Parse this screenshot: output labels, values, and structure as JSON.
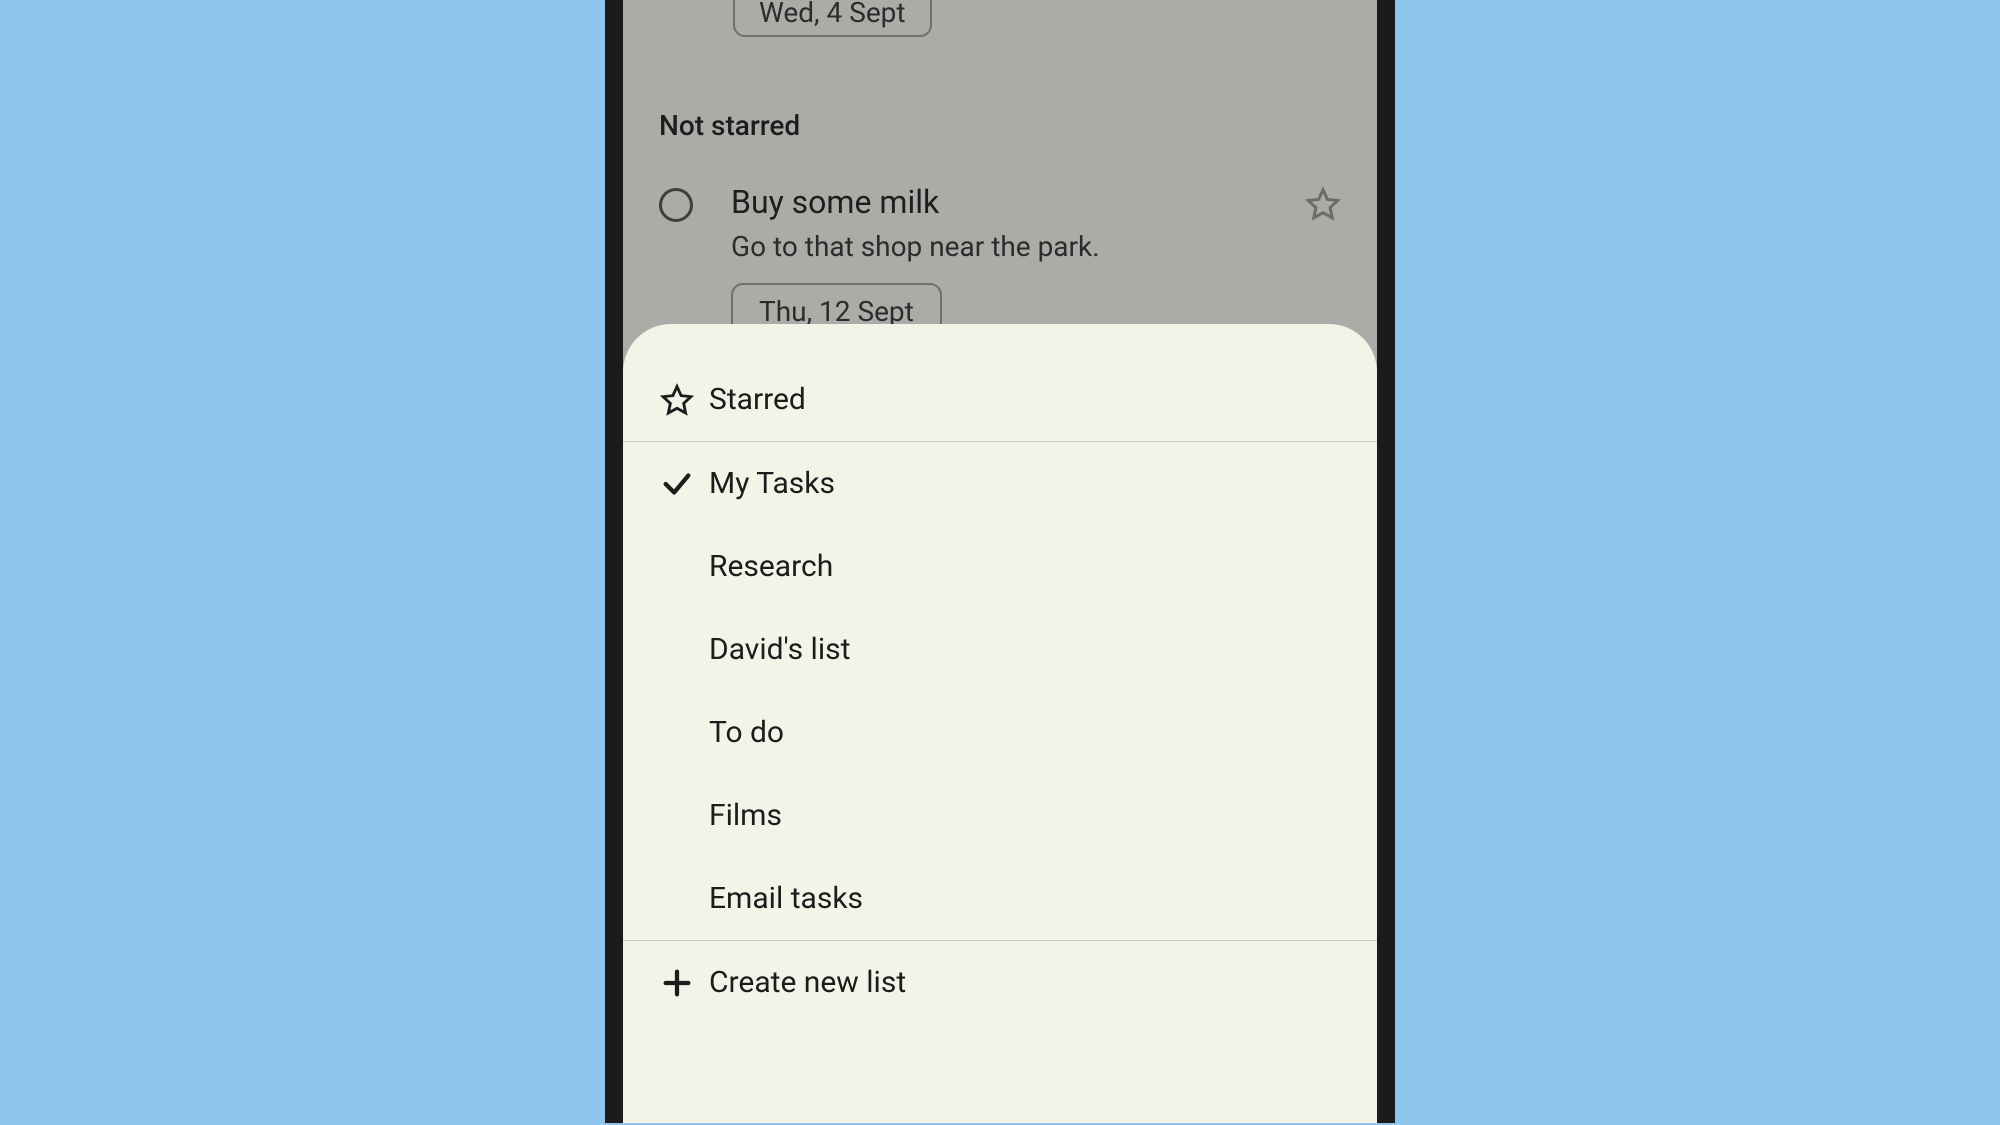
{
  "background": {
    "top_chip_date": "Wed, 4 Sept",
    "section_header": "Not starred",
    "task": {
      "title": "Buy some milk",
      "desc": "Go to that shop near the park.",
      "date": "Thu, 12 Sept"
    }
  },
  "sheet": {
    "starred_label": "Starred",
    "lists": [
      {
        "label": "My Tasks",
        "selected": true
      },
      {
        "label": "Research",
        "selected": false
      },
      {
        "label": "David's list",
        "selected": false
      },
      {
        "label": "To do",
        "selected": false
      },
      {
        "label": "Films",
        "selected": false
      },
      {
        "label": "Email tasks",
        "selected": false
      }
    ],
    "create_label": "Create new list"
  }
}
